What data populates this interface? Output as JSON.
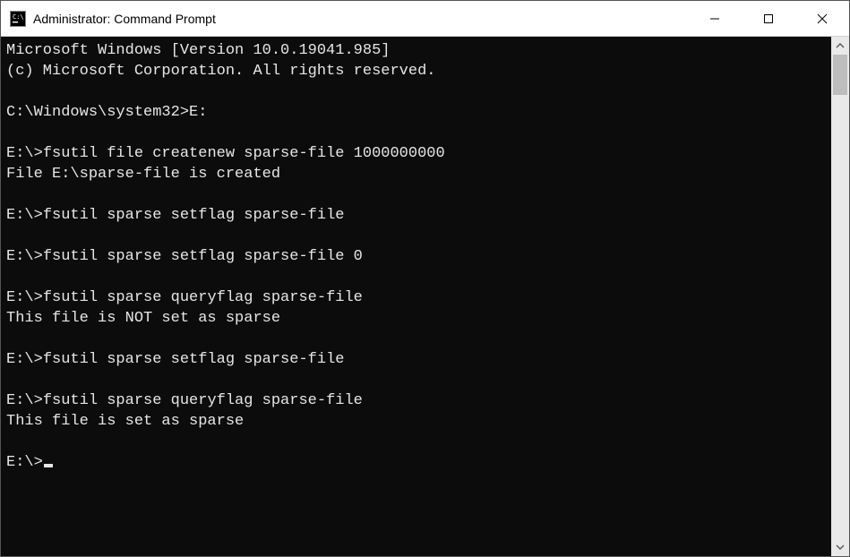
{
  "titlebar": {
    "title": "Administrator: Command Prompt"
  },
  "terminal": {
    "lines": [
      {
        "text": "Microsoft Windows [Version 10.0.19041.985]"
      },
      {
        "text": "(c) Microsoft Corporation. All rights reserved."
      },
      {
        "text": ""
      },
      {
        "prompt": "C:\\Windows\\system32>",
        "cmd": "E:"
      },
      {
        "text": ""
      },
      {
        "prompt": "E:\\>",
        "cmd": "fsutil file createnew sparse-file 1000000000"
      },
      {
        "text": "File E:\\sparse-file is created"
      },
      {
        "text": ""
      },
      {
        "prompt": "E:\\>",
        "cmd": "fsutil sparse setflag sparse-file"
      },
      {
        "text": ""
      },
      {
        "prompt": "E:\\>",
        "cmd": "fsutil sparse setflag sparse-file 0"
      },
      {
        "text": ""
      },
      {
        "prompt": "E:\\>",
        "cmd": "fsutil sparse queryflag sparse-file"
      },
      {
        "text": "This file is NOT set as sparse"
      },
      {
        "text": ""
      },
      {
        "prompt": "E:\\>",
        "cmd": "fsutil sparse setflag sparse-file"
      },
      {
        "text": ""
      },
      {
        "prompt": "E:\\>",
        "cmd": "fsutil sparse queryflag sparse-file"
      },
      {
        "text": "This file is set as sparse"
      },
      {
        "text": ""
      },
      {
        "prompt": "E:\\>",
        "cmd": "",
        "cursor": true
      }
    ]
  }
}
